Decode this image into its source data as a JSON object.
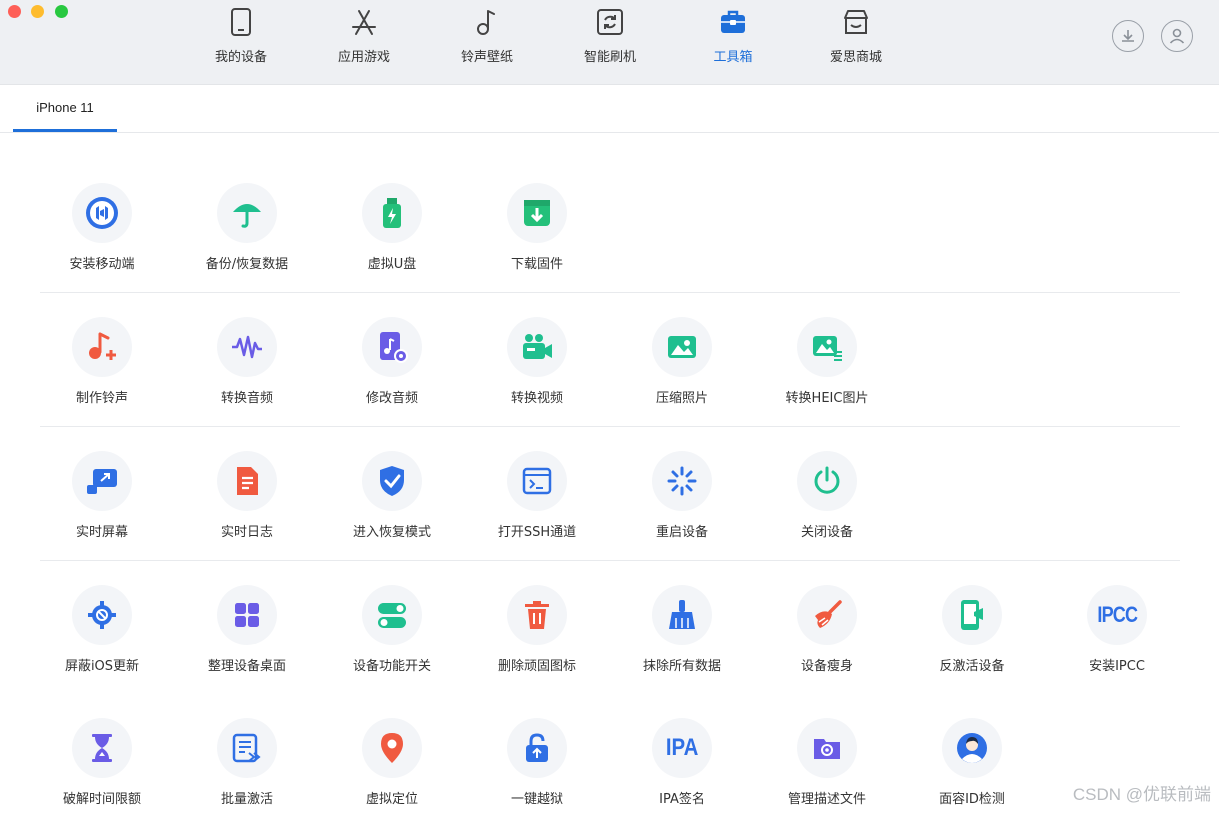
{
  "nav": {
    "items": [
      {
        "label": "我的设备",
        "icon": "phone-icon"
      },
      {
        "label": "应用游戏",
        "icon": "app-store-icon"
      },
      {
        "label": "铃声壁纸",
        "icon": "music-note-icon"
      },
      {
        "label": "智能刷机",
        "icon": "refresh-icon"
      },
      {
        "label": "工具箱",
        "icon": "toolbox-icon"
      },
      {
        "label": "爱思商城",
        "icon": "store-icon"
      }
    ],
    "active": "工具箱",
    "accent": "#1e6fd9"
  },
  "device_tab": {
    "label": "iPhone 11"
  },
  "tools": {
    "row1": [
      {
        "label": "安装移动端",
        "icon": "install-mobile-icon",
        "color": "#2f6fe4"
      },
      {
        "label": "备份/恢复数据",
        "icon": "umbrella-icon",
        "color": "#1fbf8f"
      },
      {
        "label": "虚拟U盘",
        "icon": "usb-drive-icon",
        "color": "#24c07a"
      },
      {
        "label": "下载固件",
        "icon": "download-firmware-icon",
        "color": "#24c07a"
      }
    ],
    "row2": [
      {
        "label": "制作铃声",
        "icon": "ringtone-icon",
        "color": "#f05a40"
      },
      {
        "label": "转换音频",
        "icon": "waveform-icon",
        "color": "#6a5ce6"
      },
      {
        "label": "修改音频",
        "icon": "audio-file-icon",
        "color": "#6a5ce6"
      },
      {
        "label": "转换视频",
        "icon": "video-camera-icon",
        "color": "#1fbf8f"
      },
      {
        "label": "压缩照片",
        "icon": "photo-icon",
        "color": "#1fbf8f"
      },
      {
        "label": "转换HEIC图片",
        "icon": "heic-image-icon",
        "color": "#1fbf8f"
      }
    ],
    "row3": [
      {
        "label": "实时屏幕",
        "icon": "screen-mirror-icon",
        "color": "#2f6fe4"
      },
      {
        "label": "实时日志",
        "icon": "log-document-icon",
        "color": "#f05a40"
      },
      {
        "label": "进入恢复模式",
        "icon": "shield-check-icon",
        "color": "#2f6fe4"
      },
      {
        "label": "打开SSH通道",
        "icon": "terminal-icon",
        "color": "#2f6fe4"
      },
      {
        "label": "重启设备",
        "icon": "restart-spinner-icon",
        "color": "#2f6fe4"
      },
      {
        "label": "关闭设备",
        "icon": "power-icon",
        "color": "#1fbf8f"
      }
    ],
    "row4": [
      {
        "label": "屏蔽iOS更新",
        "icon": "gear-block-icon",
        "color": "#2f6fe4"
      },
      {
        "label": "整理设备桌面",
        "icon": "grid-apps-icon",
        "color": "#6a5ce6"
      },
      {
        "label": "设备功能开关",
        "icon": "toggle-switch-icon",
        "color": "#1fbf8f"
      },
      {
        "label": "删除顽固图标",
        "icon": "trash-icon",
        "color": "#f05a40"
      },
      {
        "label": "抹除所有数据",
        "icon": "broom-icon",
        "color": "#2f6fe4"
      },
      {
        "label": "设备瘦身",
        "icon": "clean-brush-icon",
        "color": "#f05a40"
      },
      {
        "label": "反激活设备",
        "icon": "deactivate-phone-icon",
        "color": "#1fbf8f"
      },
      {
        "label": "安装IPCC",
        "icon": "ipcc-icon",
        "color": "#2f6fe4",
        "glyph": "IPCC"
      }
    ],
    "row5": [
      {
        "label": "破解时间限额",
        "icon": "hourglass-icon",
        "color": "#6a5ce6"
      },
      {
        "label": "批量激活",
        "icon": "batch-activate-icon",
        "color": "#2f6fe4"
      },
      {
        "label": "虚拟定位",
        "icon": "location-pin-icon",
        "color": "#f05a40"
      },
      {
        "label": "一键越狱",
        "icon": "unlock-icon",
        "color": "#2f6fe4"
      },
      {
        "label": "IPA签名",
        "icon": "ipa-icon",
        "color": "#2f6fe4",
        "glyph": "IPA"
      },
      {
        "label": "管理描述文件",
        "icon": "profile-folder-icon",
        "color": "#6a5ce6"
      },
      {
        "label": "面容ID检测",
        "icon": "face-id-icon",
        "color": "#2f6fe4"
      }
    ]
  },
  "watermark": "CSDN @优联前端"
}
